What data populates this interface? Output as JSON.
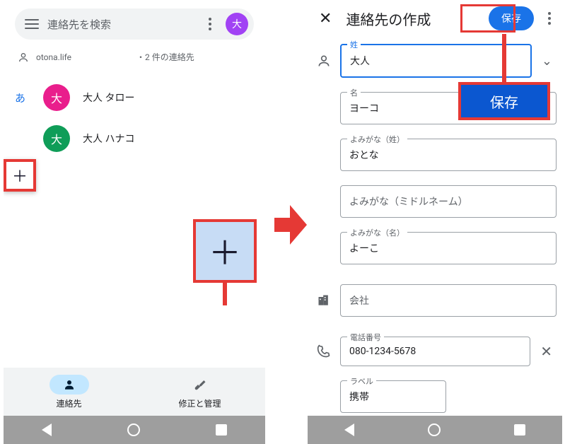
{
  "left": {
    "search_placeholder": "連絡先を検索",
    "avatar_letter": "大",
    "account": "otona.life",
    "account_meta": "・2 件の連絡先",
    "section_letter": "あ",
    "contacts": [
      {
        "initial": "大",
        "name": "大人 タロー",
        "color": "#e91e8c"
      },
      {
        "initial": "大",
        "name": "大人 ハナコ",
        "color": "#0f9d58"
      }
    ],
    "fab_big": "＋",
    "fab_small": "＋",
    "tabs": {
      "contacts": "連絡先",
      "fix": "修正と管理"
    }
  },
  "right": {
    "title": "連絡先の作成",
    "save": "保存",
    "save_big": "保存",
    "fields": {
      "sei_label": "姓",
      "sei": "大人",
      "mei_label": "名",
      "mei": "ヨーコ",
      "yomi_sei_label": "よみがな（姓）",
      "yomi_sei": "おとな",
      "yomi_mid_placeholder": "よみがな（ミドルネーム）",
      "yomi_mei_label": "よみがな（名）",
      "yomi_mei": "よーこ",
      "company_placeholder": "会社",
      "phone_label": "電話番号",
      "phone": "080-1234-5678",
      "label_label": "ラベル",
      "label_value": "携帯"
    }
  }
}
